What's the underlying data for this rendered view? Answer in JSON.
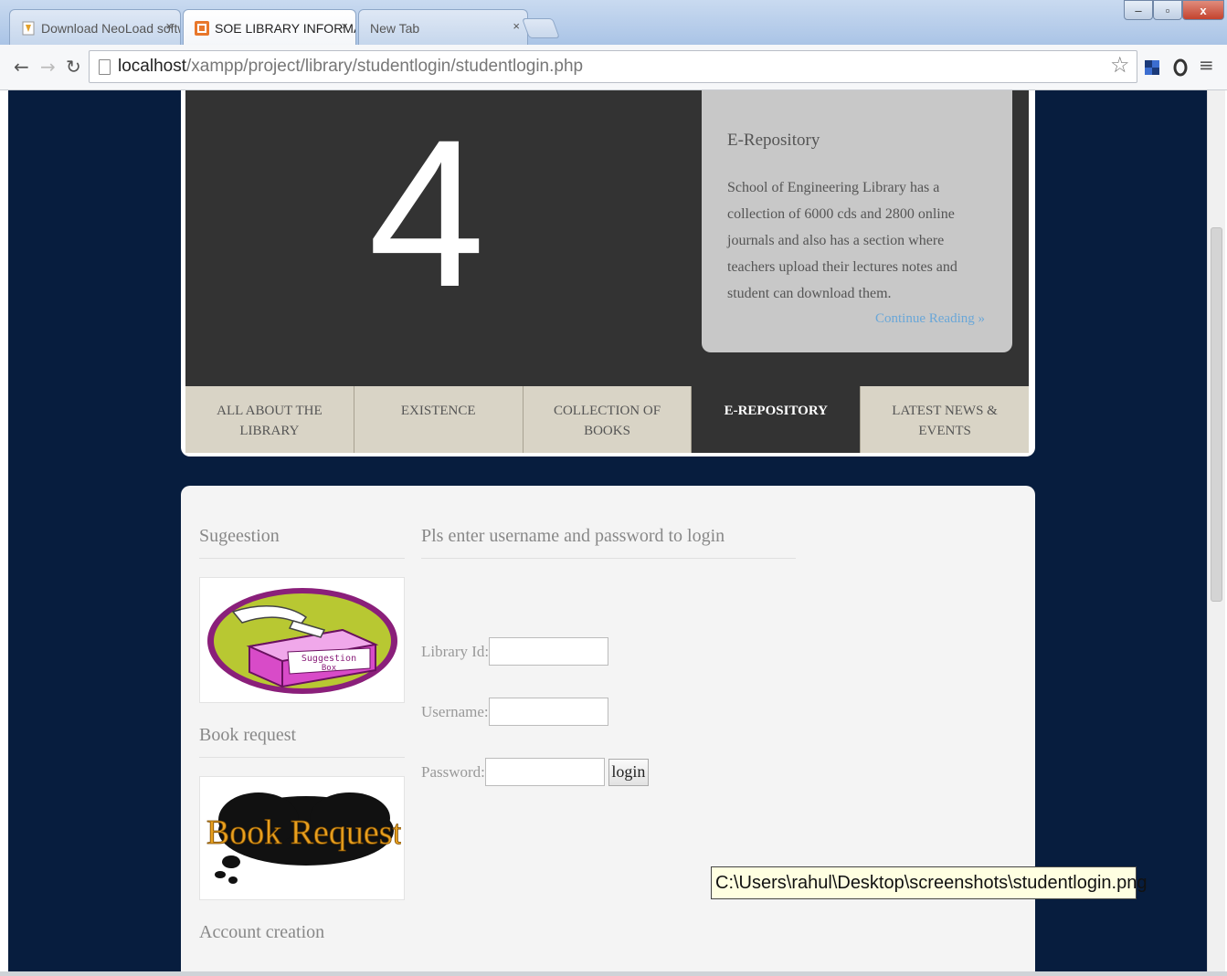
{
  "browser": {
    "tabs": [
      {
        "label": "Download NeoLoad softw",
        "active": false
      },
      {
        "label": "SOE LIBRARY INFORMATI",
        "active": true
      },
      {
        "label": "New Tab",
        "active": false
      }
    ],
    "tab_close": "×",
    "window_buttons": {
      "minimize": "–",
      "maximize": "▫",
      "close": "x"
    },
    "url_host": "localhost",
    "url_path": "/xampp/project/library/studentlogin/studentlogin.php"
  },
  "slider": {
    "number": "4",
    "info_title": "E-Repository",
    "info_body": "School of Engineering Library has a collection of 6000 cds and 2800 online journals and also has a section where teachers upload their lectures notes and student can download them.",
    "info_link": "Continue Reading »",
    "tabs": [
      {
        "label": "ALL ABOUT THE LIBRARY",
        "active": false
      },
      {
        "label": "EXISTENCE",
        "active": false
      },
      {
        "label": "COLLECTION OF BOOKS",
        "active": false
      },
      {
        "label": "E-REPOSITORY",
        "active": true
      },
      {
        "label": "LATEST NEWS & EVENTS",
        "active": false
      }
    ]
  },
  "sidebar": {
    "suggestion_heading": "Sugeestion",
    "suggestion_image_text": [
      "Suggestion",
      "Box"
    ],
    "book_heading": "Book request",
    "book_image_text": "Book Request",
    "account_heading": "Account creation"
  },
  "login": {
    "heading": "Pls enter username and password to login",
    "library_id_label": "Library Id:",
    "username_label": "Username:",
    "password_label": "Password:",
    "button_label": "login"
  },
  "tooltip": "C:\\Users\\rahul\\Desktop\\screenshots\\studentlogin.png"
}
